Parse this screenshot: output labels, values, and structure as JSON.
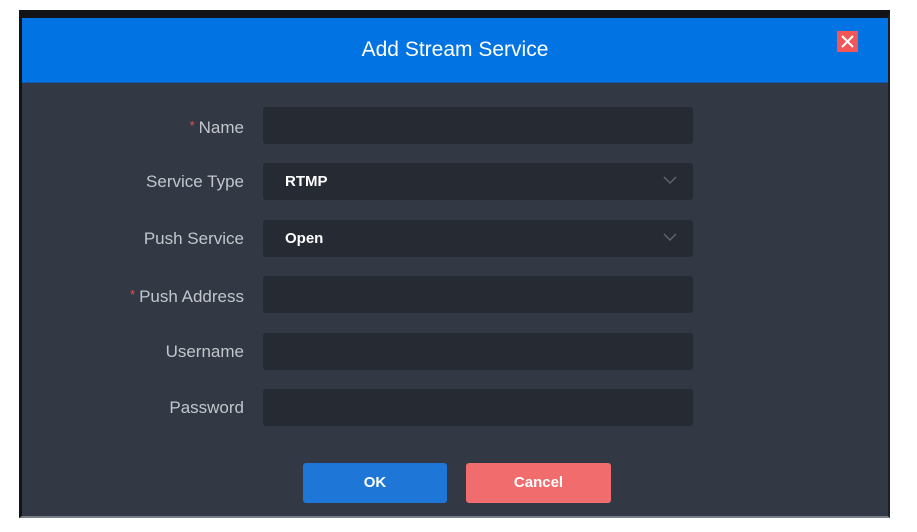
{
  "dialog": {
    "title": "Add Stream Service",
    "close_icon": "close-x-icon",
    "colors": {
      "header": "#0273e2",
      "close": "#f25656",
      "ok": "#1e76d7",
      "cancel": "#f06c6d",
      "body": "#323844",
      "field": "#262a32"
    }
  },
  "form": {
    "name": {
      "label": "Name",
      "required": true,
      "value": "",
      "placeholder": ""
    },
    "service_type": {
      "label": "Service Type",
      "value": "RTMP"
    },
    "push_service": {
      "label": "Push Service",
      "value": "Open"
    },
    "push_address": {
      "label": "Push Address",
      "required": true,
      "value": "",
      "placeholder": ""
    },
    "username": {
      "label": "Username",
      "value": "",
      "placeholder": ""
    },
    "password": {
      "label": "Password",
      "value": "",
      "placeholder": ""
    },
    "required_marker": "*"
  },
  "buttons": {
    "ok": "OK",
    "cancel": "Cancel"
  }
}
